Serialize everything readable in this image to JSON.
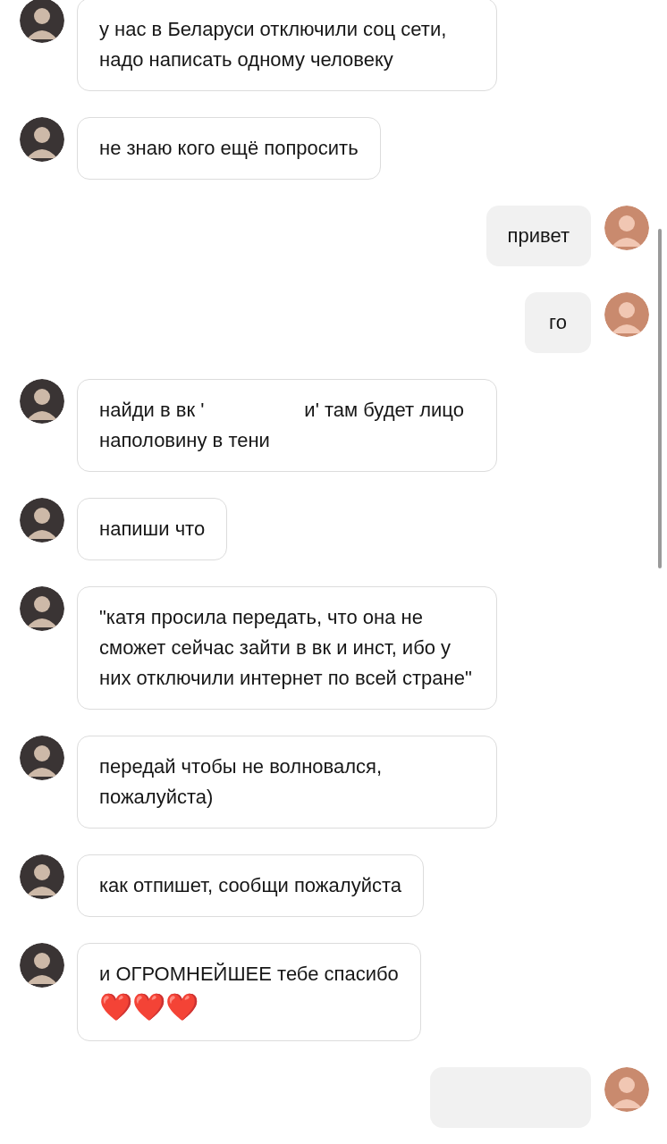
{
  "messages": [
    {
      "kind": "incoming",
      "parts": [
        {
          "kind": "text",
          "text": "у нас в Беларуси отключили соц сети, надо написать одному человеку"
        }
      ]
    },
    {
      "kind": "incoming",
      "parts": [
        {
          "kind": "text",
          "text": "не знаю кого ещё попросить"
        }
      ]
    },
    {
      "kind": "outgoing",
      "parts": [
        {
          "kind": "text",
          "text": "привет"
        }
      ]
    },
    {
      "kind": "outgoing",
      "parts": [
        {
          "kind": "text",
          "text": "го"
        }
      ]
    },
    {
      "kind": "incoming",
      "parts": [
        {
          "kind": "text",
          "text": "найди в вк '"
        },
        {
          "kind": "redacted"
        },
        {
          "kind": "text",
          "text": "и' там будет лицо наполовину в тени"
        }
      ]
    },
    {
      "kind": "incoming",
      "parts": [
        {
          "kind": "text",
          "text": "напиши что"
        }
      ]
    },
    {
      "kind": "incoming",
      "parts": [
        {
          "kind": "text",
          "text": "\"катя просила передать, что она не сможет сейчас зайти в вк и инст, ибо у них отключили интернет по всей стране\""
        }
      ]
    },
    {
      "kind": "incoming",
      "parts": [
        {
          "kind": "text",
          "text": "передай чтобы не волновался, пожалуйста)"
        }
      ]
    },
    {
      "kind": "incoming",
      "parts": [
        {
          "kind": "text",
          "text": "как отпишет, сообщи пожалуйста"
        }
      ]
    },
    {
      "kind": "incoming",
      "parts": [
        {
          "kind": "text",
          "text": "и ОГРОМНЕЙШЕЕ тебе спасибо"
        },
        {
          "kind": "emoji",
          "text": "❤️❤️❤️"
        }
      ]
    },
    {
      "kind": "outgoing"
    }
  ]
}
